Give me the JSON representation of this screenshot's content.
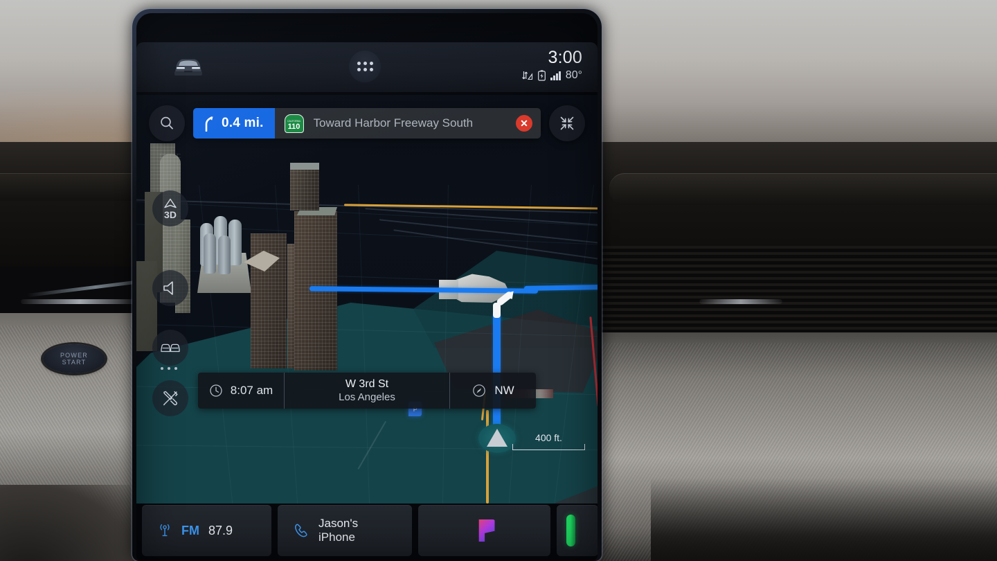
{
  "device": {
    "name": "in-car-infotainment-display"
  },
  "status_bar": {
    "vehicle_icon": "car-front-icon",
    "apps_icon": "app-grid-icon",
    "time": "3:00",
    "data_icon": "data-transfer-icon",
    "battery_icon": "battery-charging-icon",
    "signal_icon": "cellular-signal-icon",
    "temperature": "80°"
  },
  "nav_bar": {
    "search_icon": "search-icon",
    "maneuver_icon": "turn-right-fork-icon",
    "distance": "0.4 mi.",
    "shield": {
      "state_label": "CALIFORNIA",
      "route_number": "110",
      "color": "#1a8a42"
    },
    "street": "Toward Harbor Freeway South",
    "close_icon": "close-route-icon",
    "collapse_icon": "collapse-arrows-icon",
    "accent_color": "#1668e3"
  },
  "map_controls": {
    "view_mode_label": "3D",
    "view_mode_icon": "3d-perspective-icon",
    "mute_icon": "speaker-icon",
    "traffic_icon": "traffic-cars-icon",
    "traffic_more": "overflow-dots",
    "tools_icon": "tools-wrench-screwdriver-icon",
    "scale_label": "400 ft."
  },
  "map": {
    "route_color": "#1a7bf0",
    "maneuver_color": "#f4f6f8",
    "vehicle_marker": "vehicle-position-arrow",
    "poi_marker": "parking-poi-icon",
    "land_color": "#15474c",
    "background_color": "#090d14"
  },
  "info_bar": {
    "eta_icon": "clock-icon",
    "eta": "8:07 am",
    "street_line1": "W 3rd St",
    "street_line2": "Los Angeles",
    "compass_icon": "compass-icon",
    "heading": "NW"
  },
  "dock": {
    "radio": {
      "icon": "radio-broadcast-icon",
      "band": "FM",
      "frequency": "87.9"
    },
    "phone": {
      "icon": "phone-handset-icon",
      "label": "Jason's iPhone"
    },
    "pandora": {
      "icon": "pandora-app-icon"
    },
    "spotify": {
      "icon": "spotify-app-icon"
    }
  },
  "vehicle_interior": {
    "power_button_line1": "POWER",
    "power_button_line2": "START"
  }
}
